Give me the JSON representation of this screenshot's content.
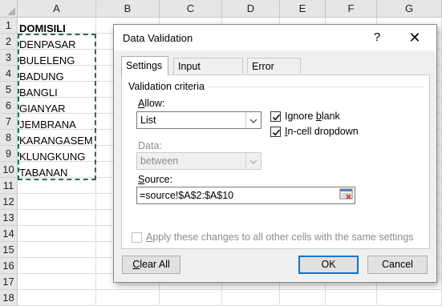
{
  "sheet": {
    "columns": [
      "A",
      "B",
      "C",
      "D",
      "E",
      "F",
      "G"
    ],
    "rows": [
      "1",
      "2",
      "3",
      "4",
      "5",
      "6",
      "7",
      "8",
      "9",
      "10",
      "11",
      "12",
      "13",
      "14",
      "15",
      "16",
      "17",
      "18"
    ],
    "column_a": [
      "DOMISILI",
      "DENPASAR",
      "BULELENG",
      "BADUNG",
      "BANGLI",
      "GIANYAR",
      "JEMBRANA",
      "KARANGASEM",
      "KLUNGKUNG",
      "TABANAN"
    ]
  },
  "dialog": {
    "title": "Data Validation",
    "help_label": "?",
    "close_label": "✕",
    "tabs": [
      "Settings",
      "Input Message",
      "Error Alert"
    ],
    "active_tab": "Settings",
    "group_title": "Validation criteria",
    "allow": {
      "label_first": "A",
      "label_rest": "llow:",
      "value": "List"
    },
    "ignore_blank": {
      "label_first": "Ignore ",
      "label_ul": "b",
      "label_rest": "lank",
      "checked": true
    },
    "incell_dropdown": {
      "label_ul": "I",
      "label_rest": "n-cell dropdown",
      "checked": true
    },
    "data": {
      "label": "Data:",
      "value": "between"
    },
    "source": {
      "label_first": "S",
      "label_rest": "ource:",
      "value": "=source!$A$2:$A$10"
    },
    "apply_all": {
      "label_ul": "A",
      "label_rest": "pply these changes to all other cells with the same settings",
      "checked": false
    },
    "buttons": {
      "clear_all": {
        "label_ul": "C",
        "label_rest": "lear All"
      },
      "ok": "OK",
      "cancel": "Cancel"
    },
    "colors": {
      "accent": "#0078d7",
      "selection_border": "#1e7145"
    }
  }
}
